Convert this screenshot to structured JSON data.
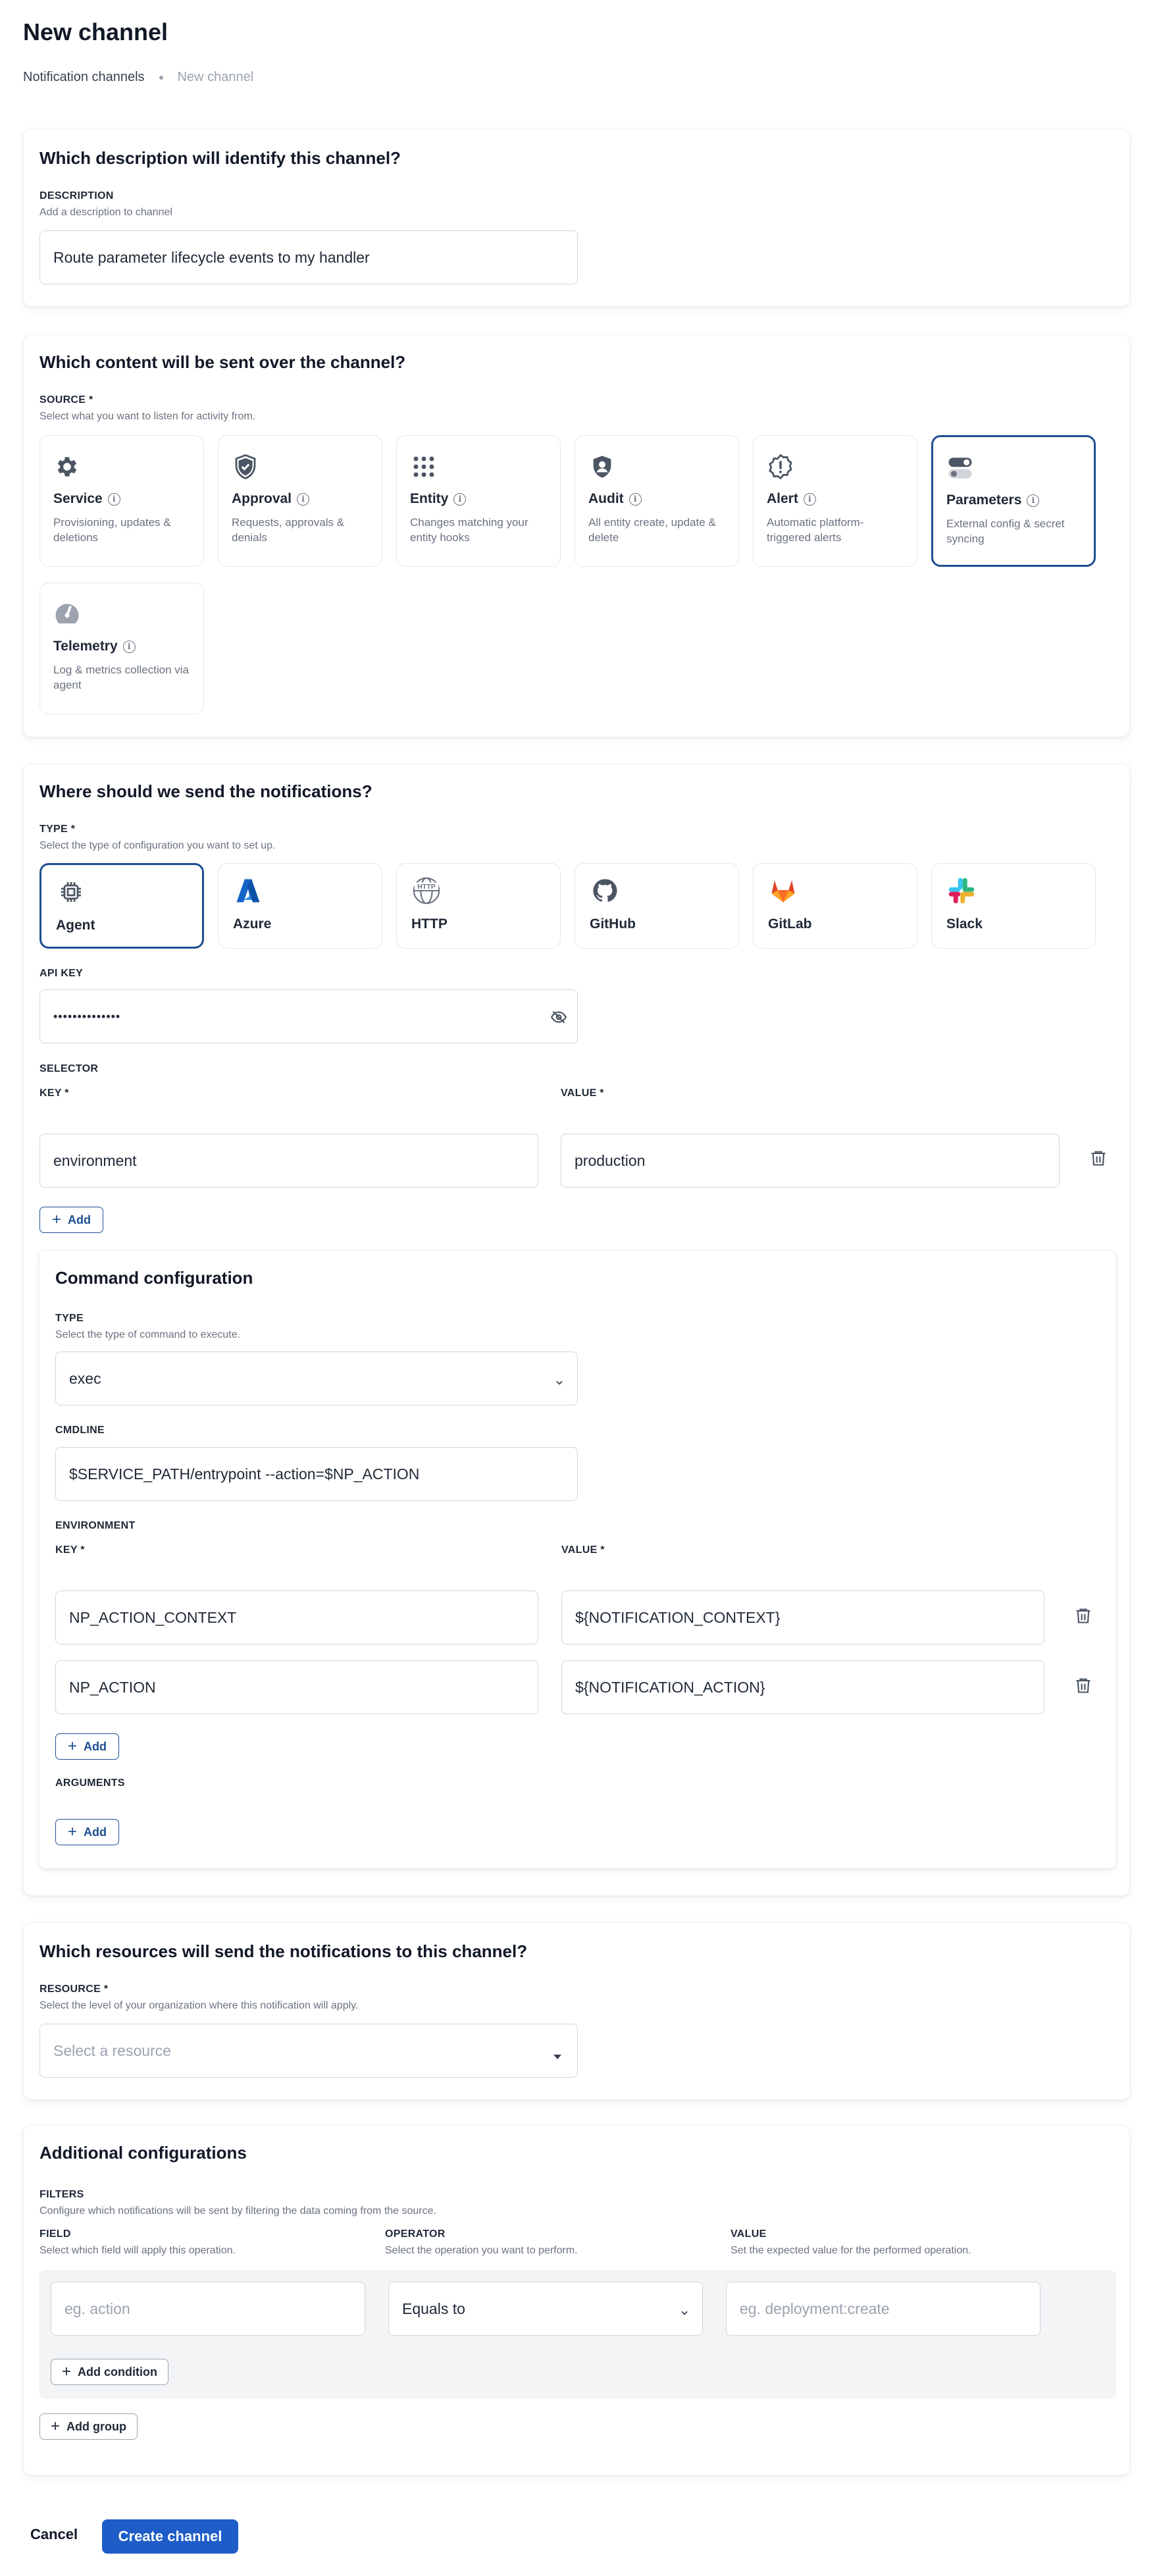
{
  "page": {
    "title": "New channel",
    "breadcrumb": {
      "parent": "Notification channels",
      "current": "New channel"
    }
  },
  "description_section": {
    "title": "Which description will identify this channel?",
    "label": "DESCRIPTION",
    "hint": "Add a description to channel",
    "value": "Route parameter lifecycle events to my handler"
  },
  "content_section": {
    "title": "Which content will be sent over the channel?",
    "label": "SOURCE *",
    "hint": "Select what you want to listen for activity from.",
    "sources": [
      {
        "name": "Service",
        "icon": "gear-icon",
        "description": "Provisioning, updates & deletions"
      },
      {
        "name": "Approval",
        "icon": "shield-check-icon",
        "description": "Requests, approvals & denials"
      },
      {
        "name": "Entity",
        "icon": "grid-dots-icon",
        "description": "Changes matching your entity hooks"
      },
      {
        "name": "Audit",
        "icon": "shield-user-icon",
        "description": "All entity create, update & delete"
      },
      {
        "name": "Alert",
        "icon": "alert-badge-icon",
        "description": "Automatic platform-triggered alerts"
      },
      {
        "name": "Parameters",
        "icon": "toggle-icon",
        "description": "External config & secret syncing",
        "selected": true
      },
      {
        "name": "Telemetry",
        "icon": "gauge-icon",
        "description": "Log & metrics collection via agent"
      }
    ]
  },
  "destination_section": {
    "title": "Where should we send the notifications?",
    "type_label": "TYPE *",
    "type_hint": "Select the type of configuration you want to set up.",
    "types": [
      {
        "name": "Agent",
        "icon": "chip-icon",
        "selected": true
      },
      {
        "name": "Azure",
        "icon": "azure-icon"
      },
      {
        "name": "HTTP",
        "icon": "http-globe-icon"
      },
      {
        "name": "GitHub",
        "icon": "github-icon"
      },
      {
        "name": "GitLab",
        "icon": "gitlab-icon"
      },
      {
        "name": "Slack",
        "icon": "slack-icon"
      }
    ],
    "api_key": {
      "label": "API KEY",
      "value": "••••••••••••••"
    },
    "selector": {
      "label": "SELECTOR",
      "key_label": "KEY *",
      "value_label": "VALUE *",
      "rows": [
        {
          "key": "environment",
          "value": "production"
        }
      ],
      "add_label": "Add"
    },
    "command": {
      "title": "Command configuration",
      "type_label": "TYPE",
      "type_hint": "Select the type of command to execute.",
      "type_value": "exec",
      "cmdline_label": "CMDLINE",
      "cmdline_value": "$SERVICE_PATH/entrypoint --action=$NP_ACTION",
      "environment_label": "ENVIRONMENT",
      "key_label": "KEY *",
      "value_label": "VALUE *",
      "env_rows": [
        {
          "key": "NP_ACTION_CONTEXT",
          "value": "${NOTIFICATION_CONTEXT}"
        },
        {
          "key": "NP_ACTION",
          "value": "${NOTIFICATION_ACTION}"
        }
      ],
      "env_add_label": "Add",
      "arguments_label": "ARGUMENTS",
      "args_add_label": "Add"
    }
  },
  "resource_section": {
    "title": "Which resources will send the notifications to this channel?",
    "label": "RESOURCE *",
    "hint": "Select the level of your organization where this notification will apply.",
    "placeholder": "Select a resource"
  },
  "additional_section": {
    "title": "Additional configurations",
    "filters_label": "FILTERS",
    "filters_hint": "Configure which notifications will be sent by filtering the data coming from the source.",
    "field_label": "FIELD",
    "field_hint": "Select which field will apply this operation.",
    "operator_label": "OPERATOR",
    "operator_hint": "Select the operation you want to perform.",
    "value_label": "VALUE",
    "value_hint": "Set the expected value for the performed operation.",
    "field_placeholder": "eg. action",
    "operator_value": "Equals to",
    "value_placeholder": "eg. deployment:create",
    "add_condition_label": "Add condition",
    "add_group_label": "Add group"
  },
  "footer": {
    "cancel_label": "Cancel",
    "create_label": "Create channel"
  },
  "colors": {
    "primary": "#1e5cc8",
    "selected_border": "#1d4f91",
    "muted_text": "#6b7280"
  }
}
